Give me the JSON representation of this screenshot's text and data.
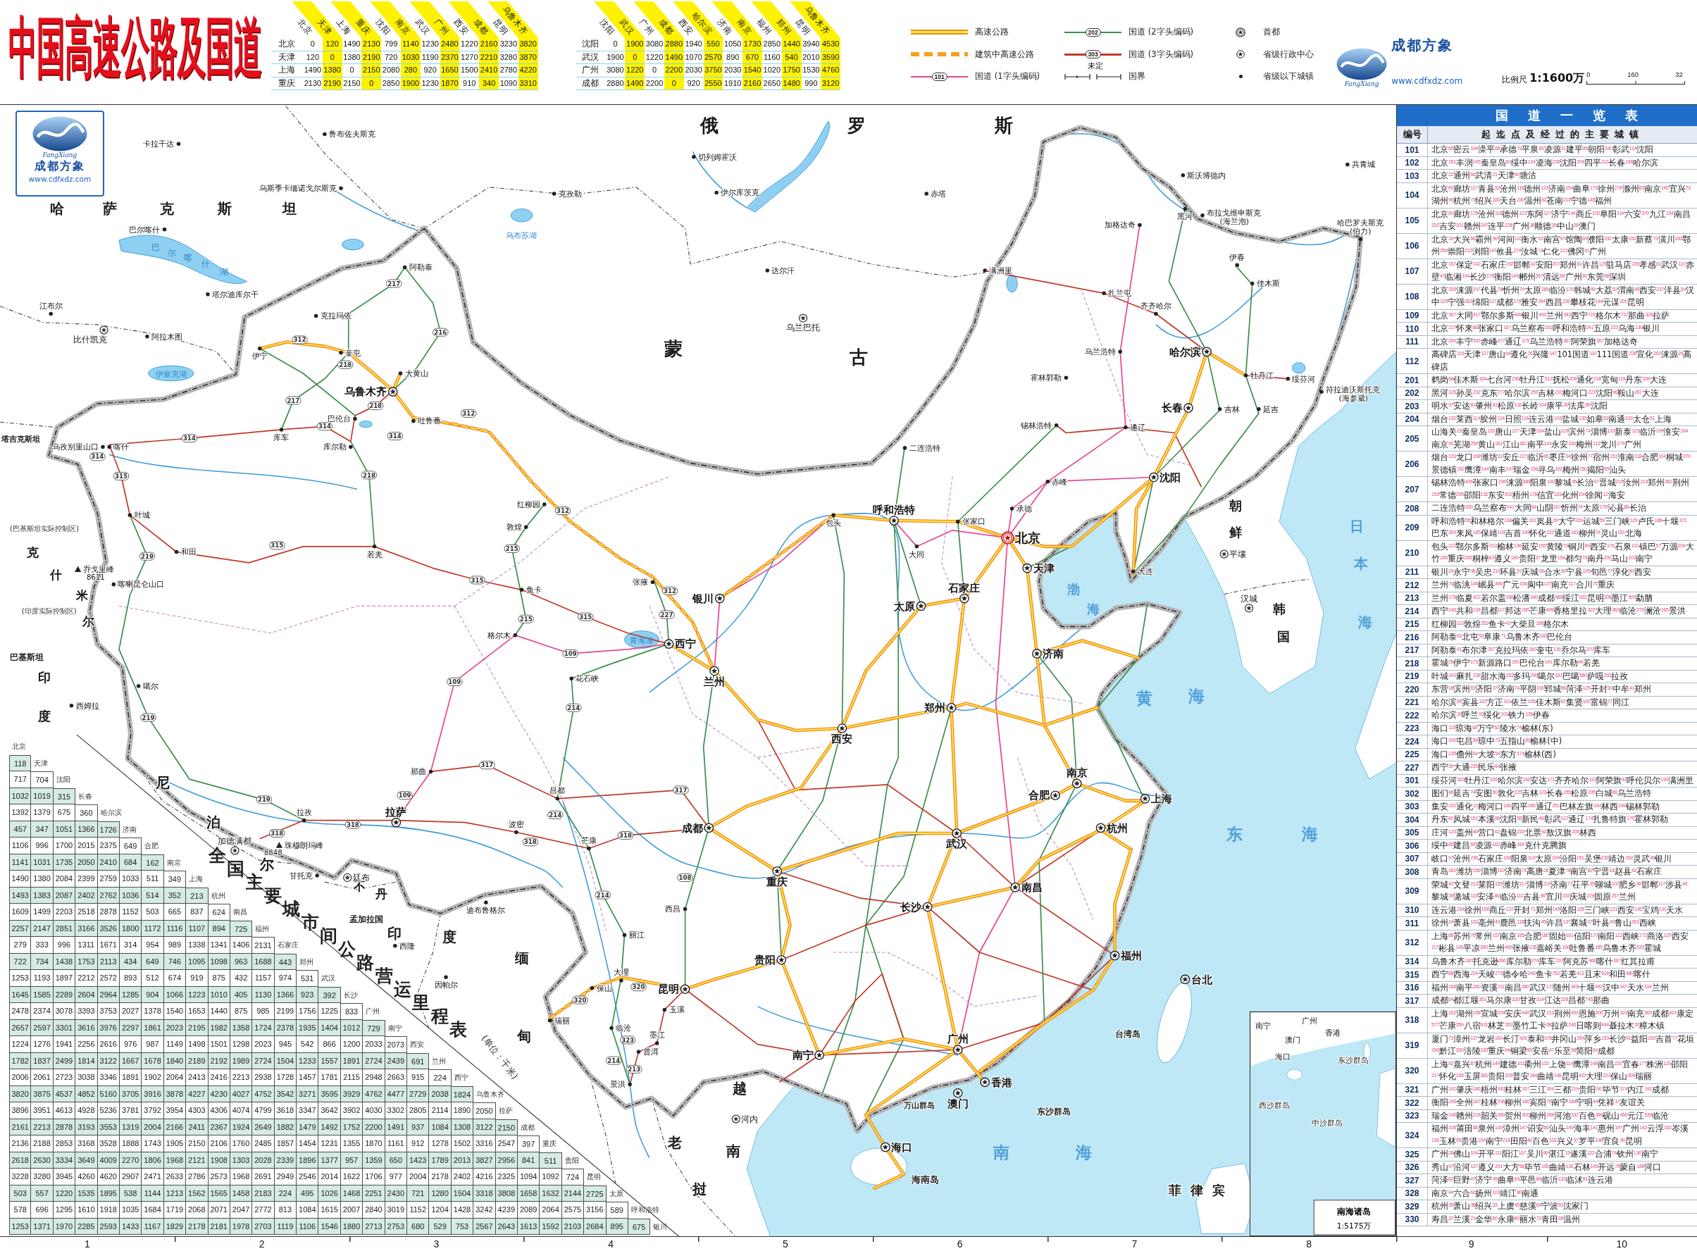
{
  "title": "中国高速公路及国道",
  "distance_tables": [
    {
      "columns": [
        "北京",
        "天津",
        "上海",
        "重庆",
        "沈阳",
        "南京",
        "武汉",
        "广州",
        "西安",
        "成都",
        "昆明",
        "乌鲁木齐"
      ],
      "rows": [
        {
          "city": "北京",
          "values": [
            "0",
            "120",
            "1490",
            "2130",
            "799",
            "1140",
            "1230",
            "2480",
            "1220",
            "2160",
            "3230",
            "3820"
          ]
        },
        {
          "city": "天津",
          "values": [
            "120",
            "0",
            "1380",
            "2190",
            "720",
            "1030",
            "1190",
            "2370",
            "1270",
            "2210",
            "3280",
            "3870"
          ]
        },
        {
          "city": "上海",
          "values": [
            "1490",
            "1380",
            "0",
            "2150",
            "2080",
            "280",
            "920",
            "1650",
            "1500",
            "2410",
            "2780",
            "4220"
          ]
        },
        {
          "city": "重庆",
          "values": [
            "2130",
            "2190",
            "2150",
            "0",
            "2850",
            "1900",
            "1230",
            "1870",
            "910",
            "340",
            "1090",
            "3310"
          ]
        }
      ]
    },
    {
      "columns": [
        "沈阳",
        "武汉",
        "广州",
        "成都",
        "西安",
        "哈尔滨",
        "济南",
        "南京",
        "福州",
        "郑州",
        "昆明",
        "乌鲁木齐"
      ],
      "rows": [
        {
          "city": "沈阳",
          "values": [
            "0",
            "1900",
            "3080",
            "2880",
            "1940",
            "550",
            "1050",
            "1730",
            "2850",
            "1440",
            "3940",
            "4530"
          ]
        },
        {
          "city": "武汉",
          "values": [
            "1900",
            "0",
            "1220",
            "1490",
            "1070",
            "2570",
            "890",
            "670",
            "1160",
            "540",
            "2010",
            "3590"
          ]
        },
        {
          "city": "广州",
          "values": [
            "3080",
            "1220",
            "0",
            "2200",
            "2030",
            "3750",
            "2030",
            "1540",
            "1020",
            "1750",
            "1530",
            "4760"
          ]
        },
        {
          "city": "成都",
          "values": [
            "2880",
            "1490",
            "2200",
            "0",
            "920",
            "2550",
            "1910",
            "2160",
            "2650",
            "1480",
            "990",
            "3120"
          ]
        }
      ]
    }
  ],
  "legend": [
    {
      "kind": "expressway",
      "label": "高速公路"
    },
    {
      "kind": "expressway_building",
      "label": "建筑中高速公路"
    },
    {
      "kind": "national_road_1",
      "label": "国道 (1字头编码)",
      "badge": "101"
    },
    {
      "kind": "national_road_2",
      "label": "国道 (2字头编码)",
      "badge": "202"
    },
    {
      "kind": "national_road_3",
      "label": "国道 (3字头编码)",
      "badge": "303"
    },
    {
      "kind": "border",
      "label": "国界",
      "note": "未定"
    },
    {
      "kind": "capital",
      "label": "首都"
    },
    {
      "kind": "provincial",
      "label": "省级行政中心"
    },
    {
      "kind": "town",
      "label": "省级以下城镇"
    }
  ],
  "publisher": {
    "brand": "成都方象",
    "caption": "FangXiang",
    "url": "www.cdfxdz.com"
  },
  "scale": {
    "label": "比例尺",
    "ratio": "1:1600万",
    "ticks": [
      "0",
      "160",
      "32"
    ]
  },
  "map": {
    "logo": {
      "brand": "成都方象",
      "caption": "FangXiang",
      "url": "www.cdfxdz.com"
    },
    "countries": [
      {
        "parts": [
          "俄",
          "罗",
          "斯"
        ]
      },
      {
        "parts": [
          "哈",
          "萨",
          "克",
          "斯",
          "坦"
        ]
      },
      {
        "parts": [
          "蒙",
          "古"
        ]
      },
      {
        "parts": [
          "塔吉克斯坦"
        ]
      },
      {
        "parts": [
          "朝",
          "鲜"
        ]
      },
      {
        "parts": [
          "克",
          "什",
          "米",
          "尔"
        ]
      },
      {
        "parts": [
          "韩",
          "国"
        ]
      },
      {
        "parts": [
          "巴基斯坦"
        ]
      },
      {
        "parts": [
          "印",
          "度"
        ]
      },
      {
        "parts": [
          "尼",
          "泊",
          "尔"
        ]
      },
      {
        "parts": [
          "不",
          "丹"
        ]
      },
      {
        "parts": [
          "孟加拉国"
        ]
      },
      {
        "parts": [
          "印",
          "度"
        ]
      },
      {
        "parts": [
          "缅",
          "甸"
        ]
      },
      {
        "parts": [
          "越",
          "南"
        ]
      },
      {
        "parts": [
          "老",
          "挝"
        ]
      },
      {
        "parts": [
          "菲",
          "律",
          "宾"
        ]
      }
    ],
    "region_notes": [
      "(巴基斯坦实际控制区)",
      "(印度实际控制区)"
    ],
    "seas": [
      {
        "parts": [
          "日",
          "本",
          "海"
        ]
      },
      {
        "parts": [
          "渤",
          "海"
        ]
      },
      {
        "parts": [
          "黄",
          "海"
        ]
      },
      {
        "parts": [
          "东",
          "海"
        ]
      },
      {
        "parts": [
          "南",
          "海"
        ]
      }
    ],
    "lakes": [
      {
        "parts": [
          "乌布苏湖"
        ]
      },
      {
        "parts": [
          "巴",
          "尔",
          "喀",
          "什",
          "湖"
        ]
      },
      {
        "parts": [
          "伊塞克湖"
        ]
      },
      {
        "parts": [
          "青海湖"
        ]
      }
    ],
    "islands": [
      "台湾岛",
      "万山群岛",
      "东沙群岛",
      "海南岛"
    ],
    "cities": [
      {
        "name": "鲁布佐夫斯克",
        "kind": "town"
      },
      {
        "name": "卡拉干达",
        "kind": "town"
      },
      {
        "name": "切列姆霍沃",
        "kind": "town"
      },
      {
        "name": "共青城",
        "kind": "town"
      },
      {
        "name": "斯沃博德内",
        "kind": "town"
      },
      {
        "name": "乌斯季卡缅诺戈尔斯克",
        "kind": "town"
      },
      {
        "name": "克孜勒",
        "kind": "town"
      },
      {
        "name": "伊尔库茨克",
        "kind": "town"
      },
      {
        "name": "赤塔",
        "kind": "town"
      },
      {
        "name": "黑河",
        "kind": "town"
      },
      {
        "name": "布拉戈维申斯克",
        "alias": "(海兰泡)",
        "kind": "town"
      },
      {
        "name": "巴尔喀什",
        "kind": "town"
      },
      {
        "name": "加格达奇",
        "kind": "town"
      },
      {
        "name": "哈巴罗夫斯克",
        "alias": "(伯力)",
        "kind": "town"
      },
      {
        "name": "伊春",
        "kind": "town"
      },
      {
        "name": "阿勒泰",
        "kind": "town"
      },
      {
        "name": "达尔汗",
        "kind": "town"
      },
      {
        "name": "满洲里",
        "kind": "town"
      },
      {
        "name": "佳木斯",
        "kind": "town"
      },
      {
        "name": "塔尔迪库尔干",
        "kind": "town"
      },
      {
        "name": "扎兰屯",
        "kind": "town"
      },
      {
        "name": "江布尔",
        "kind": "town"
      },
      {
        "name": "齐齐哈尔",
        "kind": "town"
      },
      {
        "name": "克拉玛依",
        "kind": "town"
      },
      {
        "name": "乌兰巴托",
        "kind": "foreign_capital"
      },
      {
        "name": "比什凯克",
        "kind": "foreign_capital"
      },
      {
        "name": "阿拉木图",
        "kind": "town"
      },
      {
        "name": "伊宁",
        "kind": "town"
      },
      {
        "name": "奎屯",
        "kind": "town"
      },
      {
        "name": "乌兰浩特",
        "kind": "town"
      },
      {
        "name": "哈尔滨",
        "kind": "provincial"
      },
      {
        "name": "大黄山",
        "kind": "town"
      },
      {
        "name": "霍林郭勒",
        "kind": "town"
      },
      {
        "name": "牡丹江",
        "kind": "town"
      },
      {
        "name": "绥芬河",
        "kind": "town"
      },
      {
        "name": "乌鲁木齐",
        "kind": "provincial"
      },
      {
        "name": "符拉迪沃斯托克",
        "alias": "(海参崴)",
        "kind": "town"
      },
      {
        "name": "长春",
        "kind": "provincial"
      },
      {
        "name": "吉林",
        "kind": "town"
      },
      {
        "name": "延吉",
        "kind": "town"
      },
      {
        "name": "巴伦台",
        "kind": "town"
      },
      {
        "name": "吐鲁番",
        "kind": "town"
      },
      {
        "name": "锡林浩特",
        "kind": "town"
      },
      {
        "name": "通辽",
        "kind": "town"
      },
      {
        "name": "库车",
        "kind": "town"
      },
      {
        "name": "乌孜别里山口",
        "kind": "town"
      },
      {
        "name": "喀什",
        "kind": "town"
      },
      {
        "name": "库尔勒",
        "kind": "town"
      },
      {
        "name": "二连浩特",
        "kind": "town"
      },
      {
        "name": "赤峰",
        "kind": "town"
      },
      {
        "name": "沈阳",
        "kind": "provincial"
      },
      {
        "name": "红柳园",
        "kind": "town"
      },
      {
        "name": "叶城",
        "kind": "town"
      },
      {
        "name": "呼和浩特",
        "kind": "provincial"
      },
      {
        "name": "承德",
        "kind": "town"
      },
      {
        "name": "敦煌",
        "kind": "town"
      },
      {
        "name": "包头",
        "kind": "town"
      },
      {
        "name": "张家口",
        "kind": "town"
      },
      {
        "name": "北京",
        "kind": "capital"
      },
      {
        "name": "和田",
        "kind": "town"
      },
      {
        "name": "若羌",
        "kind": "town"
      },
      {
        "name": "大同",
        "kind": "town"
      },
      {
        "name": "平壤",
        "kind": "foreign_capital"
      },
      {
        "name": "天津",
        "kind": "provincial"
      },
      {
        "name": "大连",
        "kind": "town"
      },
      {
        "name": "喀喇昆仑山口",
        "kind": "town"
      },
      {
        "name": "鱼卡",
        "kind": "town"
      },
      {
        "name": "张掖",
        "kind": "town"
      },
      {
        "name": "银川",
        "kind": "provincial"
      },
      {
        "name": "石家庄",
        "kind": "provincial"
      },
      {
        "name": "太原",
        "kind": "provincial"
      },
      {
        "name": "汉城",
        "kind": "foreign_capital"
      },
      {
        "name": "格尔木",
        "kind": "town"
      },
      {
        "name": "西宁",
        "kind": "provincial"
      },
      {
        "name": "济南",
        "kind": "provincial"
      },
      {
        "name": "噶尔",
        "kind": "town"
      },
      {
        "name": "花石峡",
        "kind": "town"
      },
      {
        "name": "兰州",
        "kind": "provincial"
      },
      {
        "name": "西姆拉",
        "kind": "town"
      },
      {
        "name": "郑州",
        "kind": "provincial"
      },
      {
        "name": "西安",
        "kind": "provincial"
      },
      {
        "name": "那曲",
        "kind": "town"
      },
      {
        "name": "南京",
        "kind": "provincial"
      },
      {
        "name": "昌都",
        "kind": "town"
      },
      {
        "name": "合肥",
        "kind": "provincial"
      },
      {
        "name": "上海",
        "kind": "provincial"
      },
      {
        "name": "拉孜",
        "kind": "town"
      },
      {
        "name": "拉萨",
        "kind": "provincial"
      },
      {
        "name": "波密",
        "kind": "town"
      },
      {
        "name": "成都",
        "kind": "provincial"
      },
      {
        "name": "杭州",
        "kind": "provincial"
      },
      {
        "name": "加德满都",
        "kind": "foreign_capital"
      },
      {
        "name": "芒康",
        "kind": "town"
      },
      {
        "name": "武汉",
        "kind": "provincial"
      },
      {
        "name": "甘托克",
        "kind": "town"
      },
      {
        "name": "廷布",
        "kind": "foreign_capital"
      },
      {
        "name": "重庆",
        "kind": "provincial"
      },
      {
        "name": "南昌",
        "kind": "provincial"
      },
      {
        "name": "迪布鲁格尔",
        "kind": "town"
      },
      {
        "name": "西昌",
        "kind": "town"
      },
      {
        "name": "长沙",
        "kind": "provincial"
      },
      {
        "name": "丽江",
        "kind": "town"
      },
      {
        "name": "西隆",
        "kind": "town"
      },
      {
        "name": "贵阳",
        "kind": "provincial"
      },
      {
        "name": "福州",
        "kind": "provincial"
      },
      {
        "name": "大理",
        "kind": "town"
      },
      {
        "name": "因帕尔",
        "kind": "town"
      },
      {
        "name": "保山",
        "kind": "town"
      },
      {
        "name": "昆明",
        "kind": "provincial"
      },
      {
        "name": "台北",
        "kind": "provincial"
      },
      {
        "name": "玉溪",
        "kind": "town"
      },
      {
        "name": "瑞丽",
        "kind": "town"
      },
      {
        "name": "临沧",
        "kind": "town"
      },
      {
        "name": "墨江",
        "kind": "town"
      },
      {
        "name": "广州",
        "kind": "provincial"
      },
      {
        "name": "普洱",
        "kind": "town"
      },
      {
        "name": "南宁",
        "kind": "provincial"
      },
      {
        "name": "景洪",
        "kind": "town"
      },
      {
        "name": "香港",
        "kind": "provincial"
      },
      {
        "name": "澳门",
        "kind": "provincial"
      },
      {
        "name": "河内",
        "kind": "foreign_capital"
      },
      {
        "name": "海口",
        "kind": "provincial"
      }
    ],
    "peaks": [
      {
        "name": "乔戈里峰",
        "elevation": "8611"
      },
      {
        "name": "珠穆朗玛峰",
        "elevation": "8848"
      }
    ],
    "road_badges": [
      "217",
      "216",
      "312",
      "218",
      "217",
      "218",
      "312",
      "314",
      "314",
      "314",
      "314",
      "218",
      "315",
      "312",
      "315",
      "215",
      "219",
      "315",
      "312",
      "227",
      "315",
      "215",
      "109",
      "109",
      "214",
      "219",
      "317",
      "317",
      "109",
      "219",
      "214",
      "318",
      "318",
      "318",
      "318",
      "108",
      "214",
      "320",
      "320",
      "323",
      "214",
      "213"
    ],
    "inset": {
      "labels": [
        "南宁",
        "广州",
        "香港",
        "澳门",
        "海口",
        "东沙群岛",
        "西沙群岛",
        "中沙群岛"
      ],
      "title": "南海诸岛",
      "scale": "1:5175万"
    }
  },
  "mileage_table": {
    "title": [
      "全",
      "国",
      "主",
      "要",
      "城",
      "市",
      "间",
      "公",
      "路",
      "营",
      "运",
      "里",
      "程",
      "表"
    ],
    "unit": "(单位：千米)",
    "rows": [
      {
        "city": "北京"
      },
      {
        "city": "天津",
        "values": [
          "118"
        ]
      },
      {
        "city": "沈阳",
        "values": [
          "717",
          "704"
        ]
      },
      {
        "city": "长春",
        "values": [
          "1032",
          "1019",
          "315"
        ]
      },
      {
        "city": "哈尔滨",
        "values": [
          "1392",
          "1379",
          "675",
          "360"
        ]
      },
      {
        "city": "济南",
        "values": [
          "457",
          "347",
          "1051",
          "1366",
          "1726"
        ]
      },
      {
        "city": "合肥",
        "values": [
          "1106",
          "996",
          "1700",
          "2015",
          "2375",
          "649"
        ]
      },
      {
        "city": "南京",
        "values": [
          "1141",
          "1031",
          "1735",
          "2050",
          "2410",
          "684",
          "162"
        ]
      },
      {
        "city": "上海",
        "values": [
          "1490",
          "1380",
          "2084",
          "2399",
          "2759",
          "1033",
          "511",
          "349"
        ]
      },
      {
        "city": "杭州",
        "values": [
          "1493",
          "1383",
          "2087",
          "2402",
          "2762",
          "1036",
          "514",
          "352",
          "213"
        ]
      },
      {
        "city": "南昌",
        "values": [
          "1609",
          "1499",
          "2203",
          "2518",
          "2878",
          "1152",
          "503",
          "665",
          "837",
          "624"
        ]
      },
      {
        "city": "福州",
        "values": [
          "2257",
          "2147",
          "2851",
          "3166",
          "3526",
          "1800",
          "1172",
          "1116",
          "1107",
          "894",
          "725"
        ]
      },
      {
        "city": "石家庄",
        "values": [
          "279",
          "333",
          "996",
          "1311",
          "1671",
          "314",
          "954",
          "989",
          "1338",
          "1341",
          "1406",
          "2131"
        ]
      },
      {
        "city": "郑州",
        "values": [
          "722",
          "734",
          "1438",
          "1753",
          "2113",
          "434",
          "649",
          "746",
          "1095",
          "1098",
          "963",
          "1688",
          "443"
        ]
      },
      {
        "city": "武汉",
        "values": [
          "1253",
          "1193",
          "1897",
          "2212",
          "2572",
          "893",
          "512",
          "674",
          "919",
          "875",
          "432",
          "1157",
          "974",
          "531"
        ]
      },
      {
        "city": "长沙",
        "values": [
          "1645",
          "1585",
          "2289",
          "2604",
          "2964",
          "1285",
          "904",
          "1066",
          "1223",
          "1010",
          "405",
          "1130",
          "1366",
          "923",
          "392"
        ]
      },
      {
        "city": "广州",
        "values": [
          "2478",
          "2374",
          "3078",
          "3393",
          "3753",
          "2027",
          "1378",
          "1540",
          "1653",
          "1440",
          "875",
          "985",
          "2199",
          "1756",
          "1225",
          "833"
        ]
      },
      {
        "city": "南宁",
        "values": [
          "2657",
          "2597",
          "3301",
          "3616",
          "3976",
          "2297",
          "1861",
          "2023",
          "2195",
          "1982",
          "1358",
          "1724",
          "2378",
          "1935",
          "1404",
          "1012",
          "729"
        ]
      },
      {
        "city": "西安",
        "values": [
          "1224",
          "1276",
          "1941",
          "2256",
          "2616",
          "976",
          "987",
          "1149",
          "1498",
          "1501",
          "1298",
          "2023",
          "945",
          "542",
          "866",
          "1200",
          "2033",
          "2073"
        ]
      },
      {
        "city": "兰州",
        "values": [
          "1782",
          "1837",
          "2499",
          "1814",
          "3122",
          "1667",
          "1678",
          "1840",
          "2189",
          "2192",
          "1989",
          "2724",
          "1504",
          "1233",
          "1557",
          "1891",
          "2724",
          "2439",
          "691"
        ]
      },
      {
        "city": "西宁",
        "values": [
          "2006",
          "2061",
          "2723",
          "3038",
          "3346",
          "1891",
          "1902",
          "2064",
          "2413",
          "2416",
          "2213",
          "2938",
          "1728",
          "1457",
          "1781",
          "2115",
          "2948",
          "2663",
          "915",
          "224"
        ]
      },
      {
        "city": "乌鲁木齐",
        "values": [
          "3820",
          "3875",
          "4537",
          "4852",
          "5160",
          "3705",
          "3916",
          "3878",
          "4227",
          "4230",
          "4027",
          "4752",
          "3542",
          "3271",
          "3595",
          "3929",
          "4762",
          "4477",
          "2729",
          "2038",
          "1824"
        ]
      },
      {
        "city": "拉萨",
        "values": [
          "3896",
          "3951",
          "4613",
          "4928",
          "5236",
          "3781",
          "3792",
          "3954",
          "4303",
          "4306",
          "4074",
          "4799",
          "3618",
          "3347",
          "3642",
          "3902",
          "4030",
          "3302",
          "2805",
          "2114",
          "1890",
          "2050"
        ]
      },
      {
        "city": "成都",
        "values": [
          "2161",
          "2213",
          "2878",
          "3193",
          "3553",
          "1319",
          "2004",
          "2166",
          "2411",
          "2367",
          "1924",
          "2649",
          "1882",
          "1479",
          "1492",
          "1752",
          "2200",
          "1491",
          "937",
          "1084",
          "1308",
          "3122",
          "2150"
        ]
      },
      {
        "city": "重庆",
        "values": [
          "2136",
          "2188",
          "2853",
          "3168",
          "3528",
          "1888",
          "1743",
          "1905",
          "2150",
          "2106",
          "1760",
          "2485",
          "1857",
          "1454",
          "1231",
          "1355",
          "1870",
          "1161",
          "912",
          "1278",
          "1502",
          "3316",
          "2547",
          "397"
        ]
      },
      {
        "city": "贵阳",
        "values": [
          "2618",
          "2630",
          "3334",
          "3649",
          "4009",
          "2270",
          "1806",
          "1968",
          "2121",
          "1908",
          "1303",
          "2028",
          "2339",
          "1896",
          "1377",
          "957",
          "1359",
          "650",
          "1423",
          "1789",
          "2013",
          "3827",
          "2956",
          "841",
          "511"
        ]
      },
      {
        "city": "昆明",
        "values": [
          "3228",
          "3280",
          "3945",
          "4260",
          "4620",
          "2907",
          "2471",
          "2633",
          "2786",
          "2573",
          "1968",
          "2691",
          "2949",
          "2546",
          "2014",
          "1622",
          "1706",
          "977",
          "2004",
          "2178",
          "2402",
          "4216",
          "2325",
          "1094",
          "1092",
          "724"
        ]
      },
      {
        "city": "太原",
        "values": [
          "503",
          "557",
          "1220",
          "1535",
          "1895",
          "538",
          "1144",
          "1213",
          "1562",
          "1565",
          "1458",
          "2183",
          "224",
          "495",
          "1026",
          "1468",
          "2251",
          "2430",
          "721",
          "1280",
          "1504",
          "3318",
          "3808",
          "1658",
          "1632",
          "2144",
          "2725"
        ]
      },
      {
        "city": "呼和浩特",
        "values": [
          "578",
          "696",
          "1295",
          "1610",
          "1918",
          "1035",
          "1684",
          "1719",
          "2068",
          "2071",
          "2047",
          "2772",
          "813",
          "1084",
          "1615",
          "2007",
          "2840",
          "3019",
          "1152",
          "1204",
          "1428",
          "3242",
          "4239",
          "2089",
          "2064",
          "2575",
          "3156",
          "589"
        ]
      },
      {
        "city": "银川",
        "values": [
          "1253",
          "1371",
          "1970",
          "2285",
          "2593",
          "1433",
          "1167",
          "1829",
          "2178",
          "2181",
          "1978",
          "2703",
          "1119",
          "1106",
          "1546",
          "1880",
          "2713",
          "2753",
          "680",
          "529",
          "753",
          "2567",
          "2643",
          "1613",
          "1592",
          "2103",
          "2684",
          "895",
          "675"
        ]
      }
    ]
  },
  "road_list": {
    "title": "国道一览表",
    "columns": [
      "编号",
      "起迄点及经过的主要城镇"
    ],
    "rows": [
      {
        "number": "101",
        "route": "北京$^{65}$密云$^{104}$滦平$^{65}$承德$^{79}$平泉$^{86}$凌源$^{31}$建平$^{85}$朝阳$^{240}$彰武$^{124}$沈阳"
      },
      {
        "number": "102",
        "route": "北京$^{151}$丰润$^{145}$秦皇岛$^{83}$绥中$^{134}$凌海$^{236}$沈阳$^{204}$四平$^{112}$长春$^{246}$哈尔滨"
      },
      {
        "number": "103",
        "route": "北京$^{22}$通州$^{66}$武清$^{21}$天津$^{40}$塘沽"
      },
      {
        "number": "104",
        "route": "北京$^{60}$廊坊$^{127}$青县$^{52}$沧州$^{116}$德州$^{123}$济南$^{154}$曲阜$^{179}$徐州$^{278}$滁州$^{83}$南京$^{145}$宜兴$^{73}$湖州$^{96}$杭州$^{73}$绍兴$^{160}$天台$^{230}$温州$^{82}$苍南$^{211}$宁德$^{145}$福州"
      },
      {
        "number": "105",
        "route": "北京$^{60}$廊坊$^{178}$沧州$^{116}$德州$^{123}$东阿$^{127}$济宁$^{144}$商丘$^{192}$阜阳$^{194}$六安$^{370}$九江$^{154}$南昌$^{220}$吉安$^{201}$赣州$^{247}$连平$^{228}$广州$^{36}$顺德$^{35}$中山$^{28}$澳门"
      },
      {
        "number": "106",
        "route": "北京$^{16}$大兴$^{66}$霸州$^{96}$河间$^{111}$衡水$^{53}$南宫$^{97}$馆陶$^{90}$濮阳$^{232}$太康$^{153}$新蔡$^{73}$潢川$^{243}$鄂州$^{259}$崇阳$^{213}$浏阳$^{147}$攸县$^{274}$汝城$^{74}$仁化$^{217}$佛冈$^{91}$广州"
      },
      {
        "number": "107",
        "route": "北京$^{157}$保定$^{142}$石家庄$^{192}$邯郸$^{42}$安阳$^{207}$郑州$^{81}$许昌$^{125}$驻马店$^{235}$孝感$^{61}$武汉$^{137}$赤壁$^{47}$临湘$^{194}$长沙$^{178}$衡阳$^{149}$郴州$^{357}$清远$^{68}$广州$^{39}$东莞$^{98}$深圳"
      },
      {
        "number": "108",
        "route": "北京$^{335}$涞源$^{197}$代县$^{78}$忻州$^{74}$太原$^{265}$临汾$^{176}$韩城$^{95}$大荔$^{62}$渭南$^{45}$西安$^{237}$洋县$^{54}$汉中$^{125}$宁强$^{283}$绵阳$^{127}$成都$^{179}$雅安$^{394}$西昌$^{226}$攀枝花$^{144}$元谋$^{200}$昆明"
      },
      {
        "number": "109",
        "route": "北京$^{367}$大同$^{417}$鄂尔多斯$^{449}$银川$^{493}$兰州$^{343}$西宁$^{723}$格尔木$^{737}$那曲$^{326}$拉萨"
      },
      {
        "number": "110",
        "route": "北京$^{127}$怀来$^{86}$张家口$^{167}$乌兰察布$^{161}$呼和浩特$^{241}$五原$^{223}$乌海$^{130}$银川"
      },
      {
        "number": "111",
        "route": "北京$^{200}$丰宁$^{339}$赤峰$^{377}$通辽$^{375}$乌兰浩特$^{367}$阿荣旗$^{307}$加格达奇"
      },
      {
        "number": "112",
        "route": "高碑店$^{115}$天津$^{127}$唐山$^{64}$遵化$^{76}$兴隆$^{147}$101国道$^{110}$111国道$^{226}$宣化$^{201}$涞源$^{29}$高碑店"
      },
      {
        "number": "201",
        "route": "鹤岗$^{66}$佳木斯$^{164}$七台河$^{236}$牡丹江$^{512}$抚松$^{206}$通化$^{218}$宽甸$^{119}$丹东$^{339}$大连"
      },
      {
        "number": "202",
        "route": "黑河$^{126}$孙吴$^{232}$克东$^{277}$哈尔滨$^{259}$吉林$^{210}$梅河口$^{223}$沈阳$^{96}$鞍山$^{287}$大连"
      },
      {
        "number": "203",
        "route": "明水$^{97}$安达$^{81}$肇州$^{83}$松原$^{132}$长岭$^{164}$康平$^{30}$法库$^{86}$沈阳"
      },
      {
        "number": "204",
        "route": "烟台$^{130}$莱西$^{114}$胶州$^{124}$日照$^{116}$连云港$^{193}$盐城$^{135}$如皋$^{53}$南通$^{103}$太仓$^{51}$上海"
      },
      {
        "number": "205",
        "route": "山海关$^{23}$秦皇岛$^{125}$唐山$^{127}$天津$^{164}$盐山$^{129}$滨州$^{74}$淄博$^{133}$新泰$^{115}$临沂$^{199}$淮安$^{184}$南京$^{90}$芜湖$^{254}$黄山$^{161}$江山$^{381}$南平$^{144}$永安$^{330}$梅州$^{112}$龙川$^{279}$广州"
      },
      {
        "number": "206",
        "route": "烟台$^{133}$龙口$^{168}$潍坊$^{31}$安丘$^{227}$临沂$^{95}$枣庄$^{94}$徐州$^{77}$宿州$^{151}$淮南$^{118}$合肥$^{104}$桐城$^{270}$景德镇$^{152}$鹰潭$^{144}$南丰$^{197}$瑞金$^{156}$寻乌$^{102}$梅州$^{150}$揭阳$^{55}$汕头"
      },
      {
        "number": "207",
        "route": "锡林浩特$^{436}$张家口$^{236}$涞源$^{389}$阳泉$^{192}$黎城$^{45}$长治$^{97}$晋城$^{215}$汝州$^{219}$郑州$^{362}$荆州$^{193}$常德$^{295}$邵阳$^{132}$东安$^{510}$梧州$^{178}$信宜$^{103}$化州$^{194}$徐闻$^{12}$海安"
      },
      {
        "number": "208",
        "route": "二连浩特$^{330}$乌兰察布$^{141}$大同$^{84}$山阴$^{167}$忻州$^{74}$太原$^{175}$沁县$^{86}$长治"
      },
      {
        "number": "209",
        "route": "呼和浩特$^{55}$和林格尔$^{138}$偏关$^{191}$岚县$^{69}$大宁$^{229}$运城$^{59}$三门峡$^{129}$卢氏$^{186}$十堰$^{372}$巴东$^{309}$来凤$^{185}$保靖$^{103}$吉首$^{149}$怀化$^{222}$通道$^{163}$柳州$^{74}$灵山$^{151}$北海"
      },
      {
        "number": "210",
        "route": "包头$^{112}$鄂尔多斯$^{212}$榆林$^{136}$延安$^{155}$黄陵$^{79}$铜川$^{89}$西安$^{176}$石泉$^{131}$镇巴$^{57}$万源$^{209}$大竹$^{206}$重庆$^{265}$桐梓$^{63}$遵义$^{180}$贵阳$^{37}$龙里$^{154}$都匀$^{79}$南丹$^{200}$马山$^{103}$南宁"
      },
      {
        "number": "211",
        "route": "银川$^{20}$永宁$^{38}$吴忠$^{210}$环县$^{57}$庆城$^{28}$合水$^{30}$宁县$^{105}$旬邑$^{77}$淳化$^{80}$西安"
      },
      {
        "number": "212",
        "route": "兰州$^{70}$临洮$^{145}$岷县$^{496}$广元$^{154}$阆中$^{137}$南充$^{117}$合川$^{75}$重庆"
      },
      {
        "number": "213",
        "route": "兰州$^{178}$临夏$^{422}$若尔盖$^{288}$松潘$^{340}$成都$^{488}$绥江$^{632}$昆明$^{308}$墨江$^{509}$勐腊"
      },
      {
        "number": "214",
        "route": "西宁$^{146}$共和$^{128}$昌都$^{117}$邦达$^{265}$芒康$^{409}$香格里拉$^{322}$大理$^{363}$临沧$^{276}$澜沧$^{165}$景洪"
      },
      {
        "number": "215",
        "route": "红柳园$^{110}$敦煌$^{252}$鱼卡$^{43}$大柴旦$^{188}$格尔木"
      },
      {
        "number": "216",
        "route": "阿勒泰$^{61}$北屯$^{53}$阜康$^{71}$乌鲁木齐$^{183}$巴伦台"
      },
      {
        "number": "217",
        "route": "阿勒泰$^{91}$布尔津$^{297}$克拉玛依$^{160}$奎屯$^{136}$乔尔马$^{370}$库车"
      },
      {
        "number": "218",
        "route": "霍城$^{25}$伊宁$^{173}$新源路口$^{200}$巴伦台$^{141}$库尔勒$^{44}$若羌"
      },
      {
        "number": "219",
        "route": "叶城$^{243}$麻扎$^{238}$甜水海$^{283}$多玛$^{290}$噶尔$^{331}$巴噶$^{560}$萨嘎$^{293}$拉孜"
      },
      {
        "number": "220",
        "route": "东营$^{18}$滨州$^{81}$济阳$^{37}$济南$^{74}$平阴$^{106}$郓城$^{58}$菏泽$^{125}$开封$^{30}$中牟$^{41}$郑州"
      },
      {
        "number": "221",
        "route": "哈尔滨$^{65}$宾县$^{120}$方正$^{101}$依兰$^{105}$佳木斯$^{92}$集贤$^{100}$富锦$^{77}$同江"
      },
      {
        "number": "222",
        "route": "哈尔滨$^{30}$呼兰$^{92}$绥化$^{101}$铁力$^{135}$伊春"
      },
      {
        "number": "223",
        "route": "海口$^{115}$琼海$^{69}$万宁$^{62}$陵水$^{74}$榆林(东)"
      },
      {
        "number": "224",
        "route": "海口$^{100}$屯昌$^{56}$琼中$^{73}$五指山$^{60}$榆林(中)"
      },
      {
        "number": "225",
        "route": "海口$^{135}$儋州$^{64}$大坡$^{54}$东方$^{174}$榆林(西)"
      },
      {
        "number": "227",
        "route": "西宁$^{39}$大通$^{235}$民乐$^{64}$张掖"
      },
      {
        "number": "301",
        "route": "绥芬河$^{163}$牡丹江$^{335}$哈尔滨$^{160}$安达$^{171}$齐齐哈尔$^{193}$阿荣旗$^{42}$呼伦贝尔$^{190}$满洲里"
      },
      {
        "number": "302",
        "route": "图们$^{46}$延吉$^{74}$安图$^{60}$敦化$^{225}$吉林$^{123}$长春$^{155}$松原$^{205}$白城$^{88}$乌兰浩特"
      },
      {
        "number": "303",
        "route": "集安$^{102}$通化$^{10}$梅河口$^{146}$四平$^{186}$通辽$^{251}$巴林左旗$^{144}$林西$^{242}$锡林郭勒"
      },
      {
        "number": "304",
        "route": "丹东$^{60}$凤城$^{151}$本溪$^{86}$沈阳$^{55}$新民$^{46}$彰武$^{127}$通辽$^{174}$扎鲁特旗$^{175}$霍林郭勒"
      },
      {
        "number": "305",
        "route": "庄河$^{123}$盖州$^{40}$营口$^{62}$盘锦$^{233}$北票$^{92}$敖汉旗$^{206}$林西"
      },
      {
        "number": "306",
        "route": "绥中$^{85}$建昌$^{69}$凌源$^{162}$赤峰$^{164}$克什克腾旗"
      },
      {
        "number": "307",
        "route": "岐口$^{97}$沧州$^{236}$石家庄$^{108}$阳泉$^{110}$太原$^{104}$汾阳$^{151}$吴堡$^{232}$靖边$^{262}$灵武$^{49}$银川"
      },
      {
        "number": "308",
        "route": "青岛$^{181}$潍坊$^{156}$淄博$^{110}$济南$^{79}$高唐$^{28}$夏津$^{78}$南宫$^{82}$宁晋$^{18}$赵县$^{43}$石家庄"
      },
      {
        "number": "309",
        "route": "荣城$^{42}$文登$^{213}$莱阳$^{155}$潍坊$^{117}$淄博$^{110}$济南$^{77}$茌平$^{35}$聊城$^{102}$肥乡$^{48}$邯郸$^{117}$涉县$^{49}$黎城$^{26}$潞城$^{119}$安泽$^{86}$临汾$^{111}$吉县$^{96}$宜川$^{333}$庆城$^{229}$固原$^{257}$兰州"
      },
      {
        "number": "310",
        "route": "连云港$^{234}$徐州$^{158}$商丘$^{137}$开封$^{71}$郑州$^{145}$洛阳$^{155}$三门峡$^{121}$西安$^{145}$宝鸡$^{131}$天水"
      },
      {
        "number": "311",
        "route": "徐州$^{24}$萧县$^{132}$亳州$^{43}$鹿邑$^{118}$扶沟$^{45}$许昌$^{137}$襄城$^{27}$叶县$^{49}$鲁山$^{263}$西峡"
      },
      {
        "number": "312",
        "route": "上海$^{86}$苏州$^{76}$常州$^{157}$南京$^{165}$合肥$^{180}$固始$^{161}$信阳$^{170}$南阳$^{122}$西峡$^{172}$商洛$^{129}$西安$^{117}$彬县$^{145}$平凉$^{350}$兰州$^{469}$张掖$^{235}$嘉峪关$^{160}$吐鲁番$^{185}$乌鲁木齐$^{539}$霍城"
      },
      {
        "number": "314",
        "route": "乌鲁木齐$^{180}$托克逊$^{266}$库尔勒$^{274}$库车$^{237}$阿克苏$^{466}$喀什$^{397}$红其拉甫"
      },
      {
        "number": "315",
        "route": "西宁$^{88}$西海$^{224}$天峻$^{279}$德令哈$^{246}$鱼卡$^{752}$若羌$^{412}$且末$^{618}$和田$^{480}$喀什"
      },
      {
        "number": "316",
        "route": "福州$^{168}$南平$^{280}$资溪$^{211}$南昌$^{380}$武汉$^{172}$随州$^{343}$十堰$^{442}$汉中$^{347}$天水$^{334}$兰州"
      },
      {
        "number": "317",
        "route": "成都$^{64}$都江堰$^{351}$马尔康$^{326}$甘孜$^{314}$江达$^{228}$昌都$^{745}$那曲"
      },
      {
        "number": "318",
        "route": "上海$^{152}$湖州$^{158}$宣城$^{204}$安庆$^{440}$武汉$^{213}$荆州$^{409}$恩施$^{200}$万州$^{324}$南充$^{300}$成都$^{424}$康定$^{577}$芒康$^{359}$八宿$^{431}$林芝$^{352}$墨竹工卡$^{68}$拉萨$^{246}$日喀则$^{444}$聂拉木$^{30}$樟木镇"
      },
      {
        "number": "319",
        "route": "厦门$^{71}$漳州$^{137}$龙岩$^{160}$长汀$^{426}$泰和$^{109}$井冈山$^{264}$萍乡$^{153}$长沙$^{91}$益阳$^{163}$吉首$^{77}$花垣$^{296}$黔江$^{330}$涪陵$^{183}$重庆$^{94}$铜梁$^{95}$安岳$^{47}$乐至$^{58}$简阳$^{64}$成都"
      },
      {
        "number": "320",
        "route": "上海$^{92}$嘉兴$^{87}$杭州$^{144}$建德$^{101}$衢州$^{133}$上饶$^{114}$鹰潭$^{148}$南昌$^{220}$宜春$^{177}$株洲$^{120}$邵阳$^{217}$怀化$^{158}$玉屏$^{381}$贵阳$^{209}$普安$^{184}$曲靖$^{148}$昆明$^{422}$大理$^{221}$保山$^{306}$瑞丽"
      },
      {
        "number": "321",
        "route": "广州$^{142}$肇庆$^{186}$梧州$^{343}$桂林$^{167}$三江$^{304}$三都$^{219}$贵阳$^{247}$毕节$^{374}$内江$^{192}$成都"
      },
      {
        "number": "322",
        "route": "衡阳$^{245}$全州$^{167}$桂林$^{206}$柳州$^{180}$宾阳$^{75}$南宁$^{184}$宁明$^{44}$凭祥$^{17}$友谊关"
      },
      {
        "number": "323",
        "route": "瑞金$^{146}$赣州$^{228}$韶关$^{350}$贺州$^{300}$柳州$^{208}$河池$^{332}$百色$^{384}$砚山$^{450}$元江$^{530}$临沧"
      },
      {
        "number": "324",
        "route": "福州$^{108}$莆田$^{88}$泉州$^{130}$漳州$^{147}$诏安$^{66}$汕头$^{149}$海丰$^{141}$惠州$^{197}$广州$^{142}$云浮$^{163}$岑溪$^{136}$玉林$^{95}$贵港$^{154}$南宁$^{218}$田阳$^{46}$百色$^{318}$兴义$^{97}$罗平$^{148}$宜良$^{49}$昆明"
      },
      {
        "number": "325",
        "route": "广州$^{26}$佛山$^{104}$开平$^{111}$阳江$^{167}$吴川$^{46}$湛江$^{15}$遂溪$^{122}$合浦$^{74}$钦州$^{136}$南宁"
      },
      {
        "number": "326",
        "route": "秀山$^{97}$沿河$^{127}$遵义$^{201}$大方$^{58}$毕节$^{105}$曲靖$^{136}$石林$^{145}$开远$^{75}$蒙自$^{186}$河口"
      },
      {
        "number": "327",
        "route": "菏泽$^{62}$巨野$^{47}$济宁$^{45}$曲阜$^{69}$平邑$^{84}$临沂$^{133}$临沭$^{81}$连云港"
      },
      {
        "number": "328",
        "route": "南京$^{44}$六合$^{62}$扬州$^{103}$靖江$^{80}$南通"
      },
      {
        "number": "329",
        "route": "杭州$^{35}$萧山$^{38}$绍兴$^{33}$上虞$^{45}$慈溪$^{64}$宁波$^{81}$沈家门"
      },
      {
        "number": "330",
        "route": "寿昌$^{37}$兰溪$^{27}$金华$^{50}$永康$^{80}$丽水$^{72}$青田$^{65}$温州"
      }
    ]
  },
  "grid_columns": [
    "1",
    "2",
    "3",
    "4",
    "5",
    "6",
    "7",
    "8",
    "9",
    "10"
  ]
}
